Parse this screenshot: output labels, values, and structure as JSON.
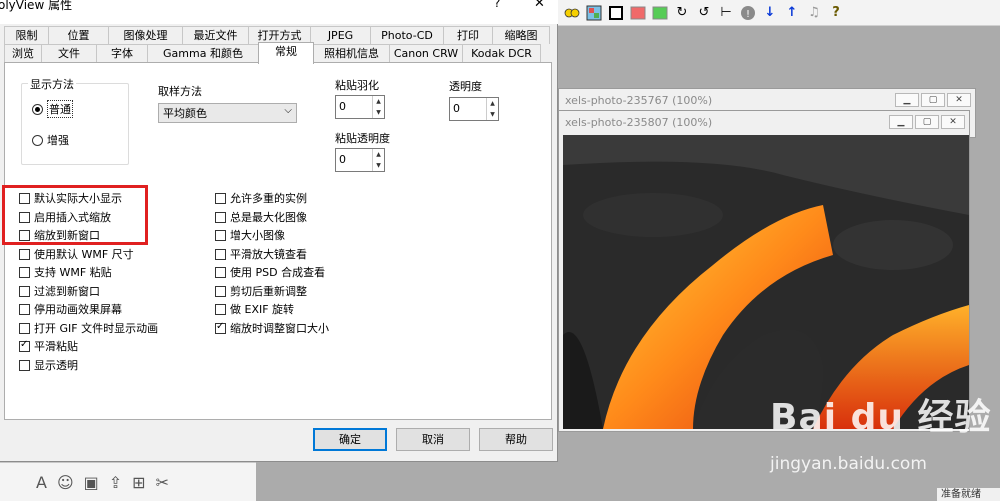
{
  "dialog": {
    "title": "olyView 属性",
    "help_glyph": "?",
    "close_glyph": "✕",
    "tabs_row1": [
      "限制",
      "位置",
      "图像处理",
      "最近文件",
      "打开方式",
      "JPEG",
      "Photo-CD",
      "打印",
      "缩略图"
    ],
    "tabs_row2": [
      "浏览",
      "文件",
      "字体",
      "Gamma 和颜色",
      "常规",
      "照相机信息",
      "Canon CRW",
      "Kodak DCR"
    ],
    "active_tab": "常规",
    "display_method": {
      "group_label": "显示方法",
      "normal": "普通",
      "enhanced": "增强",
      "selected": "普通"
    },
    "sampling": {
      "label": "取样方法",
      "value": "平均颜色"
    },
    "paste_feather": {
      "label": "粘贴羽化",
      "value": "0"
    },
    "transparency": {
      "label": "透明度",
      "value": "0"
    },
    "paste_transparency": {
      "label": "粘贴透明度",
      "value": "0"
    },
    "left_options": [
      {
        "label": "默认实际大小显示",
        "checked": false
      },
      {
        "label": "启用插入式缩放",
        "checked": false
      },
      {
        "label": "缩放到新窗口",
        "checked": false
      },
      {
        "label": "使用默认 WMF 尺寸",
        "checked": false
      },
      {
        "label": "支持 WMF 粘贴",
        "checked": false
      },
      {
        "label": "过滤到新窗口",
        "checked": false
      },
      {
        "label": "停用动画效果屏幕",
        "checked": false
      },
      {
        "label": "打开 GIF 文件时显示动画",
        "checked": false
      },
      {
        "label": "平滑粘贴",
        "checked": true
      },
      {
        "label": "显示透明",
        "checked": false
      }
    ],
    "right_options": [
      {
        "label": "允许多重的实例",
        "checked": false
      },
      {
        "label": "总是最大化图像",
        "checked": false
      },
      {
        "label": "增大小图像",
        "checked": false
      },
      {
        "label": "平滑放大镜查看",
        "checked": false
      },
      {
        "label": "使用 PSD 合成查看",
        "checked": false
      },
      {
        "label": "剪切后重新调整",
        "checked": false
      },
      {
        "label": "做 EXIF 旋转",
        "checked": false
      },
      {
        "label": "缩放时调整窗口大小",
        "checked": true
      }
    ],
    "buttons": {
      "ok": "确定",
      "cancel": "取消",
      "help": "帮助"
    }
  },
  "windows": [
    {
      "title": "xels-photo-235767 (100%)"
    },
    {
      "title": "xels-photo-235807 (100%)"
    }
  ],
  "statusbar": {
    "text": "准备就绪"
  },
  "watermark": {
    "brand": "Bai du 经验",
    "url": "jingyan.baidu.com"
  },
  "colors": {
    "highlight": "#e02020",
    "default_button": "#0078d7",
    "workspace": "#ababab"
  },
  "toolbar_icons": [
    "circles-icon",
    "palette-icon",
    "square-outline-icon",
    "red-square-icon",
    "green-square-icon",
    "rotate-right-icon",
    "rotate-left-icon",
    "crop-icon",
    "info-icon",
    "arrow-down-icon",
    "arrow-up-icon",
    "music-note-icon",
    "question-icon"
  ]
}
